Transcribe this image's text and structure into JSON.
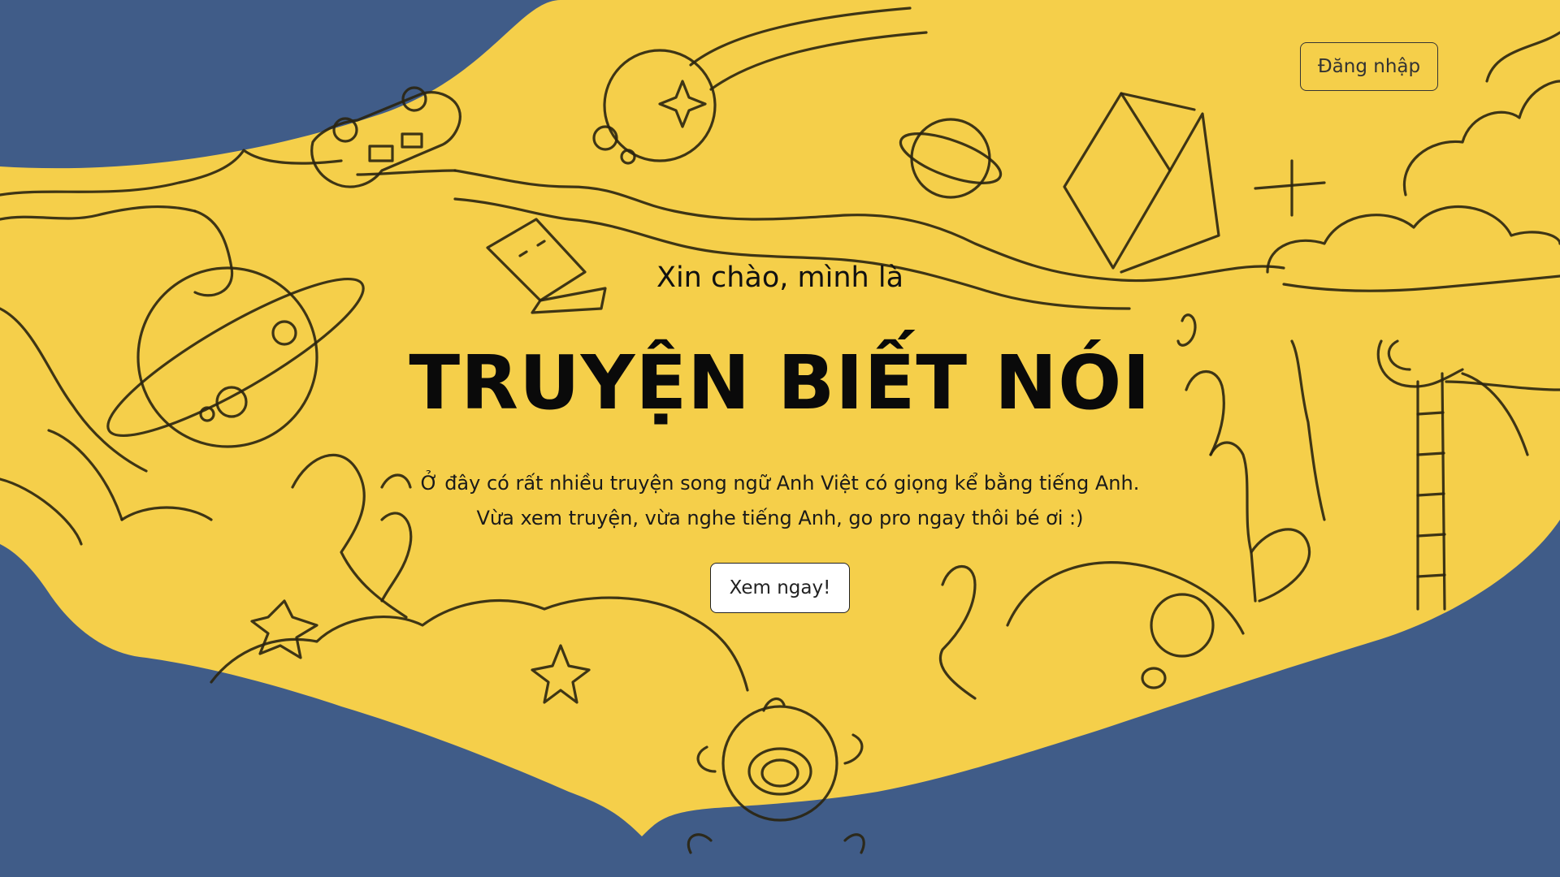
{
  "nav": {
    "login_label": "Đăng nhập"
  },
  "hero": {
    "greeting": "Xin chào, mình là",
    "title": "TRUYỆN BIẾT NÓI",
    "description_lines": [
      "Ở đây có rất nhiều truyện song ngữ Anh Việt có giọng kể bằng tiếng Anh.",
      "Vừa xem truyện, vừa nghe tiếng Anh, go pro ngay thôi bé ơi :)"
    ],
    "cta_label": "Xem ngay!"
  },
  "theme": {
    "background_color": "#405c88",
    "blob_color": "#f5cf4a",
    "ink_color": "#2a2410"
  },
  "illustration": {
    "doodles": [
      "car-icon",
      "moon-star-icon",
      "planet-icon",
      "book-icon",
      "sparkle-icon",
      "ringed-planet-icon",
      "cloud-icon",
      "ladder-icon",
      "star-icon",
      "astronaut-icon"
    ]
  }
}
